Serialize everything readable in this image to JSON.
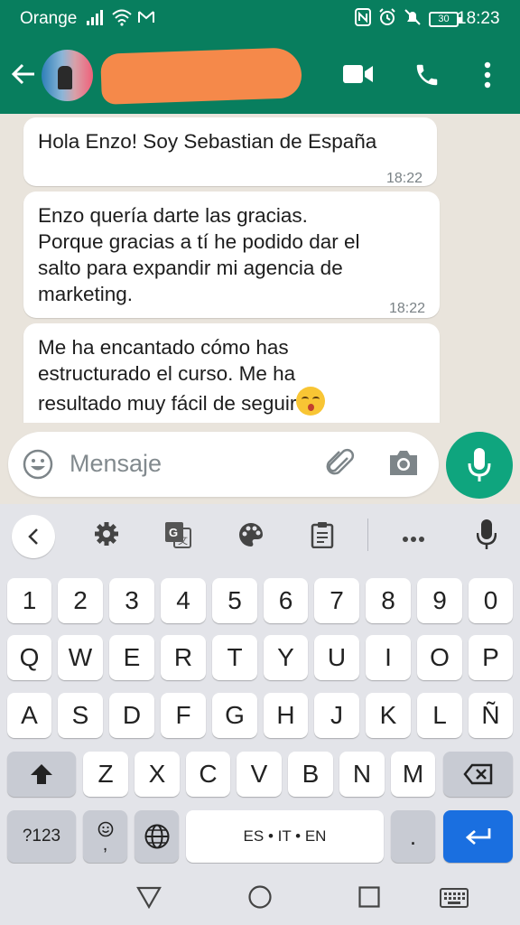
{
  "status_bar": {
    "carrier": "Orange",
    "battery": "30",
    "time": "18:23"
  },
  "header": {
    "contact_name": "",
    "icons": [
      "back-arrow-icon",
      "video-call-icon",
      "phone-icon",
      "more-vert-icon"
    ]
  },
  "messages": [
    {
      "text": "Hola Enzo! Soy Sebastian de España",
      "time": "18:22"
    },
    {
      "text": "Enzo quería darte las gracias.\nPorque gracias a tí he podido dar el\nsalto para expandir mi agencia de\nmarketing.",
      "time": "18:22"
    },
    {
      "text": "Me ha encantado cómo has\nestructurado el curso. Me ha\nresultado muy fácil de seguir",
      "emoji": "kissing-smiling-eyes-emoji"
    }
  ],
  "composer": {
    "placeholder": "Mensaje"
  },
  "keyboard": {
    "toolbar_icons": [
      "chevron-left-icon",
      "settings-icon",
      "translate-icon",
      "palette-icon",
      "clipboard-icon",
      "more-horiz-icon",
      "mic-icon"
    ],
    "number_row": [
      "1",
      "2",
      "3",
      "4",
      "5",
      "6",
      "7",
      "8",
      "9",
      "0"
    ],
    "row1": [
      "Q",
      "W",
      "E",
      "R",
      "T",
      "Y",
      "U",
      "I",
      "O",
      "P"
    ],
    "row2": [
      "A",
      "S",
      "D",
      "F",
      "G",
      "H",
      "J",
      "K",
      "L",
      "Ñ"
    ],
    "row3": [
      "Z",
      "X",
      "C",
      "V",
      "B",
      "N",
      "M"
    ],
    "symbols_label": "?123",
    "emoji_key_sub": ",",
    "space_label": "ES • IT • EN",
    "period_label": "."
  },
  "colors": {
    "header_green": "#087e5e",
    "mic_button": "#0fa57e",
    "enter_key": "#1a6fe0",
    "chat_bg": "#e9e4dc",
    "keyboard_bg": "#e3e4e9"
  }
}
